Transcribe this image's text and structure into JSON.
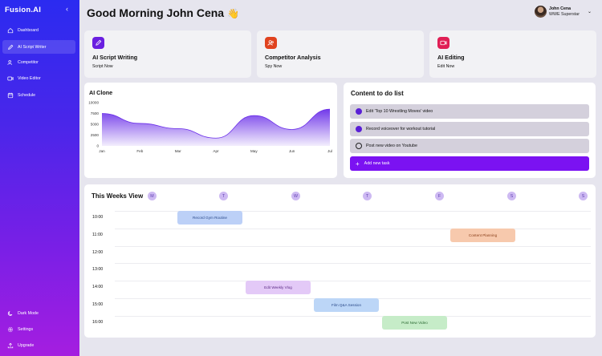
{
  "sidebar": {
    "brand": "Fusion.AI",
    "items": [
      {
        "label": "Dashboard",
        "icon": "home-icon"
      },
      {
        "label": "AI Script Writer",
        "icon": "pen-icon",
        "active": true
      },
      {
        "label": "Competitor",
        "icon": "users-icon"
      },
      {
        "label": "Video Editor",
        "icon": "video-icon"
      },
      {
        "label": "Schedule",
        "icon": "calendar-icon"
      }
    ],
    "bottom": [
      {
        "label": "Dark Mode",
        "icon": "moon-icon"
      },
      {
        "label": "Settings",
        "icon": "gear-icon"
      },
      {
        "label": "Upgrade",
        "icon": "upload-icon"
      }
    ]
  },
  "header": {
    "greeting": "Good Morning John Cena",
    "wave": "👋",
    "user_name": "John Cena",
    "user_role": "WWE Superstar"
  },
  "feature_cards": [
    {
      "title": "AI Script Writing",
      "action": "Script Now",
      "color": "#6a1fe0",
      "icon": "pen-icon"
    },
    {
      "title": "Competitor Analysis",
      "action": "Spy Now",
      "color": "#e0431f",
      "icon": "users-icon"
    },
    {
      "title": "AI Editing",
      "action": "Edit Now",
      "color": "#e01f55",
      "icon": "video-icon"
    }
  ],
  "chart_data": {
    "type": "area",
    "title": "AI Clone",
    "categories": [
      "Jan",
      "Feb",
      "Mar",
      "Apr",
      "May",
      "Jun",
      "Jul"
    ],
    "values": [
      7500,
      5200,
      4000,
      1800,
      7000,
      3800,
      8500
    ],
    "yticks": [
      0,
      2500,
      5000,
      7500,
      10000
    ],
    "ylim": [
      0,
      10000
    ],
    "color": "#6a2ee8"
  },
  "todo": {
    "title": "Content to do list",
    "items": [
      {
        "label": "Edit 'Top 10 Wrestling Moves' video",
        "done": true
      },
      {
        "label": "Record voiceover for workout tutorial",
        "done": true
      },
      {
        "label": "Post new video on Youtube",
        "done": false
      }
    ],
    "add_label": "Add new task"
  },
  "week": {
    "title": "This Weeks View",
    "days": [
      "M",
      "T",
      "W",
      "T",
      "F",
      "S",
      "S"
    ],
    "times": [
      "10:00",
      "11:00",
      "12:00",
      "13:00",
      "14:00",
      "15:00",
      "16:00"
    ],
    "events": [
      {
        "label": "Record Gym Routine",
        "bg": "#bcd0f7",
        "fg": "#2b4a8a"
      },
      {
        "label": "Content Planning",
        "bg": "#f7c9ad",
        "fg": "#8a3f1a"
      },
      {
        "label": "Edit Weekly Vlog",
        "bg": "#e3c9f7",
        "fg": "#5b2a86"
      },
      {
        "label": "Film Q&A Session",
        "bg": "#bcd6f7",
        "fg": "#2b4a8a"
      },
      {
        "label": "Post New Video",
        "bg": "#c6ecc8",
        "fg": "#2b6a32"
      }
    ]
  }
}
